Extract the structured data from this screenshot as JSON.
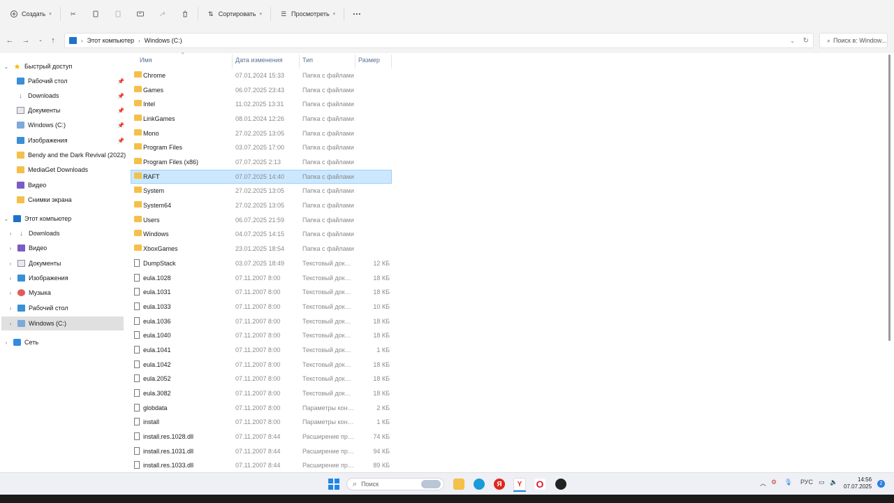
{
  "toolbar": {
    "create_label": "Создать",
    "sort_label": "Сортировать",
    "view_label": "Просмотреть",
    "more_label": "···"
  },
  "address": {
    "crumbs": [
      "Этот компьютер",
      "Windows (C:)"
    ],
    "search_placeholder": "Поиск в: Window..."
  },
  "sidebar": {
    "quick_access": {
      "label": "Быстрый доступ",
      "items": [
        {
          "label": "Рабочий стол",
          "icon": "desktop-icon",
          "pinned": true
        },
        {
          "label": "Downloads",
          "icon": "downloads-icon",
          "pinned": true
        },
        {
          "label": "Документы",
          "icon": "documents-icon",
          "pinned": true
        },
        {
          "label": "Windows (C:)",
          "icon": "drive-icon",
          "pinned": true
        },
        {
          "label": "Изображения",
          "icon": "pictures-icon",
          "pinned": true
        },
        {
          "label": "Bendy and the Dark Revival (2022)",
          "icon": "folder-icon",
          "pinned": false
        },
        {
          "label": "MediaGet Downloads",
          "icon": "folder-icon",
          "pinned": false
        },
        {
          "label": "Видео",
          "icon": "videos-icon",
          "pinned": false
        },
        {
          "label": "Снимки экрана",
          "icon": "folder-icon",
          "pinned": false
        }
      ]
    },
    "this_pc": {
      "label": "Этот компьютер",
      "items": [
        {
          "label": "Downloads",
          "icon": "downloads-icon"
        },
        {
          "label": "Видео",
          "icon": "videos-icon"
        },
        {
          "label": "Документы",
          "icon": "documents-icon"
        },
        {
          "label": "Изображения",
          "icon": "pictures-icon"
        },
        {
          "label": "Музыка",
          "icon": "music-icon"
        },
        {
          "label": "Рабочий стол",
          "icon": "desktop-icon"
        },
        {
          "label": "Windows (C:)",
          "icon": "drive-icon",
          "selected": true
        }
      ]
    },
    "network": {
      "label": "Сеть"
    }
  },
  "columns": {
    "name": "Имя",
    "date": "Дата изменения",
    "type": "Тип",
    "size": "Размер"
  },
  "files": [
    {
      "name": "Chrome",
      "date": "07.01.2024 15:33",
      "type": "Папка с файлами",
      "size": "",
      "kind": "folder"
    },
    {
      "name": "Games",
      "date": "06.07.2025 23:43",
      "type": "Папка с файлами",
      "size": "",
      "kind": "folder"
    },
    {
      "name": "Intel",
      "date": "11.02.2025 13:31",
      "type": "Папка с файлами",
      "size": "",
      "kind": "folder"
    },
    {
      "name": "LinkGames",
      "date": "08.01.2024 12:26",
      "type": "Папка с файлами",
      "size": "",
      "kind": "folder"
    },
    {
      "name": "Mono",
      "date": "27.02.2025 13:05",
      "type": "Папка с файлами",
      "size": "",
      "kind": "folder"
    },
    {
      "name": "Program Files",
      "date": "03.07.2025 17:00",
      "type": "Папка с файлами",
      "size": "",
      "kind": "folder"
    },
    {
      "name": "Program Files (x86)",
      "date": "07.07.2025 2:13",
      "type": "Папка с файлами",
      "size": "",
      "kind": "folder"
    },
    {
      "name": "RAFT",
      "date": "07.07.2025 14:40",
      "type": "Папка с файлами",
      "size": "",
      "kind": "folder",
      "selected": true
    },
    {
      "name": "System",
      "date": "27.02.2025 13:05",
      "type": "Папка с файлами",
      "size": "",
      "kind": "folder"
    },
    {
      "name": "System64",
      "date": "27.02.2025 13:05",
      "type": "Папка с файлами",
      "size": "",
      "kind": "folder"
    },
    {
      "name": "Users",
      "date": "06.07.2025 21:59",
      "type": "Папка с файлами",
      "size": "",
      "kind": "folder"
    },
    {
      "name": "Windows",
      "date": "04.07.2025 14:15",
      "type": "Папка с файлами",
      "size": "",
      "kind": "folder"
    },
    {
      "name": "XboxGames",
      "date": "23.01.2025 18:54",
      "type": "Папка с файлами",
      "size": "",
      "kind": "folder"
    },
    {
      "name": "DumpStack",
      "date": "03.07.2025 18:49",
      "type": "Текстовый докум...",
      "size": "12 КБ",
      "kind": "file"
    },
    {
      "name": "eula.1028",
      "date": "07.11.2007 8:00",
      "type": "Текстовый докум...",
      "size": "18 КБ",
      "kind": "file"
    },
    {
      "name": "eula.1031",
      "date": "07.11.2007 8:00",
      "type": "Текстовый докум...",
      "size": "18 КБ",
      "kind": "file"
    },
    {
      "name": "eula.1033",
      "date": "07.11.2007 8:00",
      "type": "Текстовый докум...",
      "size": "10 КБ",
      "kind": "file"
    },
    {
      "name": "eula.1036",
      "date": "07.11.2007 8:00",
      "type": "Текстовый докум...",
      "size": "18 КБ",
      "kind": "file"
    },
    {
      "name": "eula.1040",
      "date": "07.11.2007 8:00",
      "type": "Текстовый докум...",
      "size": "18 КБ",
      "kind": "file"
    },
    {
      "name": "eula.1041",
      "date": "07.11.2007 8:00",
      "type": "Текстовый докум...",
      "size": "1 КБ",
      "kind": "file"
    },
    {
      "name": "eula.1042",
      "date": "07.11.2007 8:00",
      "type": "Текстовый докум...",
      "size": "18 КБ",
      "kind": "file"
    },
    {
      "name": "eula.2052",
      "date": "07.11.2007 8:00",
      "type": "Текстовый докум...",
      "size": "18 КБ",
      "kind": "file"
    },
    {
      "name": "eula.3082",
      "date": "07.11.2007 8:00",
      "type": "Текстовый докум...",
      "size": "18 КБ",
      "kind": "file"
    },
    {
      "name": "globdata",
      "date": "07.11.2007 8:00",
      "type": "Параметры конф...",
      "size": "2 КБ",
      "kind": "file"
    },
    {
      "name": "install",
      "date": "07.11.2007 8:00",
      "type": "Параметры конф...",
      "size": "1 КБ",
      "kind": "file"
    },
    {
      "name": "install.res.1028.dll",
      "date": "07.11.2007 8:44",
      "type": "Расширение при...",
      "size": "74 КБ",
      "kind": "file"
    },
    {
      "name": "install.res.1031.dll",
      "date": "07.11.2007 8:44",
      "type": "Расширение при...",
      "size": "94 КБ",
      "kind": "file"
    },
    {
      "name": "install.res.1033.dll",
      "date": "07.11.2007 8:44",
      "type": "Расширение при...",
      "size": "89 КБ",
      "kind": "file"
    }
  ],
  "taskbar": {
    "search_label": "Поиск",
    "lang": "РУС",
    "time": "14:56",
    "date": "07.07.2025",
    "notifications": "2"
  }
}
